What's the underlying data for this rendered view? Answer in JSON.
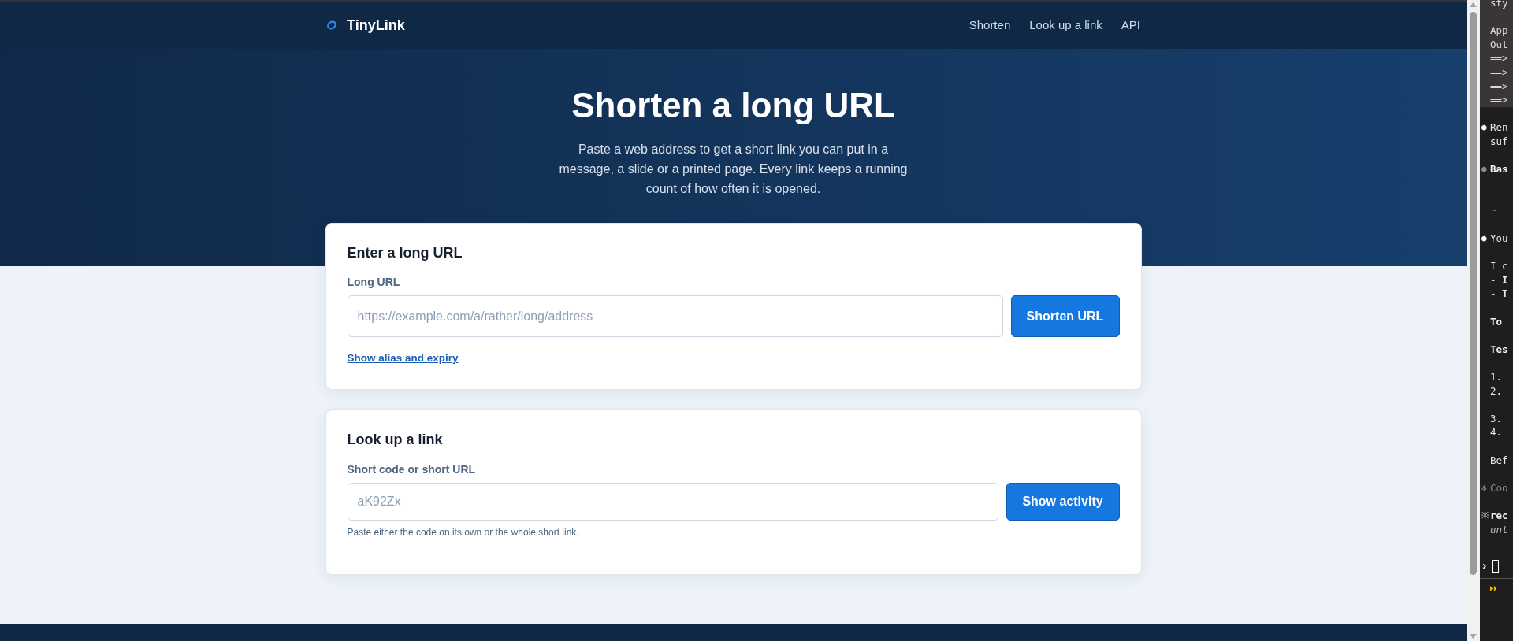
{
  "header": {
    "brand": "TinyLink",
    "nav": [
      "Shorten",
      "Look up a link",
      "API"
    ]
  },
  "hero": {
    "title": "Shorten a long URL",
    "subtitle": "Paste a web address to get a short link you can put in a message, a slide or a printed page. Every link keeps a running count of how often it is opened."
  },
  "shorten_card": {
    "title": "Enter a long URL",
    "field_label": "Long URL",
    "placeholder": "https://example.com/a/rather/long/address",
    "button": "Shorten URL",
    "link": "Show alias and expiry"
  },
  "lookup_card": {
    "title": "Look up a link",
    "field_label": "Short code or short URL",
    "placeholder": "aK92Zx",
    "button": "Show activity",
    "hint": "Paste either the code on its own or the whole short link."
  },
  "terminal": {
    "lines": [
      {
        "kind": "output",
        "text": "sty"
      },
      {
        "kind": "output"
      },
      {
        "kind": "output",
        "text": "App"
      },
      {
        "kind": "output",
        "text": "Out"
      },
      {
        "kind": "output",
        "text": "==>"
      },
      {
        "kind": "output",
        "text": "==>"
      },
      {
        "kind": "output",
        "text": "==>"
      },
      {
        "kind": "output",
        "text": "==>"
      },
      {
        "kind": "blank"
      },
      {
        "kind": "plain",
        "marker": "●",
        "text": "Ren"
      },
      {
        "kind": "plain",
        "text": "suf"
      },
      {
        "kind": "blank"
      },
      {
        "kind": "tool",
        "marker": "●",
        "text": "Bas"
      },
      {
        "kind": "dim",
        "text": "└"
      },
      {
        "kind": "blank"
      },
      {
        "kind": "dim",
        "text": "└"
      },
      {
        "kind": "blank"
      },
      {
        "kind": "plain",
        "marker": "●",
        "text": "You"
      },
      {
        "kind": "blank"
      },
      {
        "kind": "plain",
        "text": "I c"
      },
      {
        "kind": "plain",
        "text": "- **I**"
      },
      {
        "kind": "plain",
        "text": "- **T**"
      },
      {
        "kind": "blank"
      },
      {
        "kind": "bold",
        "text": "To"
      },
      {
        "kind": "blank"
      },
      {
        "kind": "bold",
        "text": "Tes"
      },
      {
        "kind": "blank"
      },
      {
        "kind": "plain",
        "text": "1."
      },
      {
        "kind": "plain",
        "text": "2."
      },
      {
        "kind": "blank"
      },
      {
        "kind": "plain",
        "text": "3."
      },
      {
        "kind": "plain",
        "text": "4."
      },
      {
        "kind": "blank"
      },
      {
        "kind": "plain",
        "text": "Bef"
      },
      {
        "kind": "blank"
      },
      {
        "kind": "status",
        "marker": "✻",
        "text": "Coo"
      },
      {
        "kind": "blank"
      },
      {
        "kind": "bold",
        "marker": "※",
        "text": "rec"
      },
      {
        "kind": "italic",
        "text": "unt"
      }
    ],
    "prompt": "›",
    "mode_marker": "⏵⏵"
  }
}
